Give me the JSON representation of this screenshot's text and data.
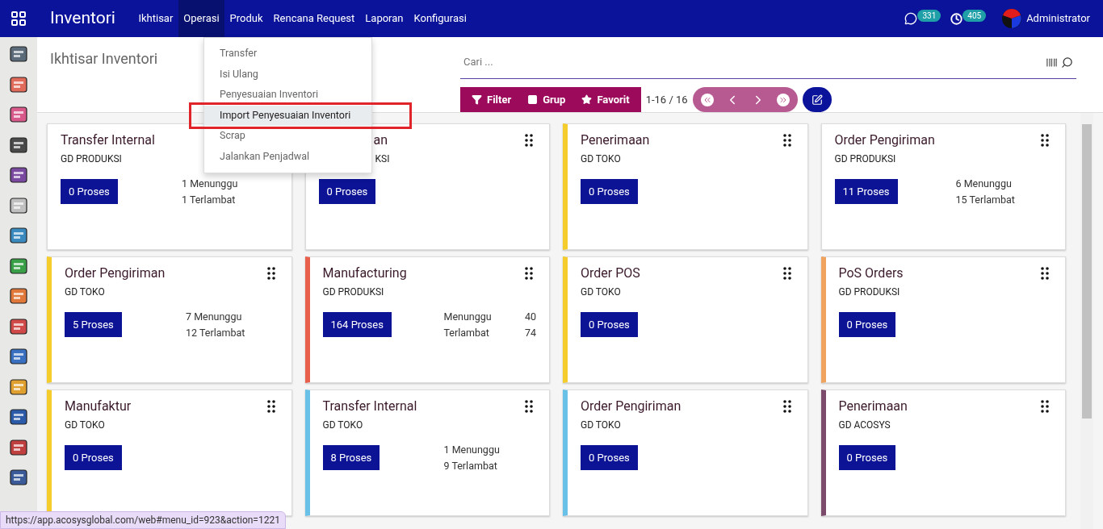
{
  "app_title": "Inventori",
  "nav": [
    {
      "label": "Ikhtisar",
      "selected": false
    },
    {
      "label": "Operasi",
      "selected": true
    },
    {
      "label": "Produk",
      "selected": false
    },
    {
      "label": "Rencana Request",
      "selected": false
    },
    {
      "label": "Laporan",
      "selected": false
    },
    {
      "label": "Konfigurasi",
      "selected": false
    }
  ],
  "messages_count": "331",
  "activities_count": "405",
  "user": "Administrator",
  "dropdown": [
    {
      "label": "Transfer",
      "selected": false
    },
    {
      "label": "Isi Ulang",
      "selected": false
    },
    {
      "label": "Penyesuaian Inventori",
      "selected": false
    },
    {
      "label": "Import Penyesuaian Inventori",
      "selected": true
    },
    {
      "label": "Scrap",
      "selected": false
    },
    {
      "label": "Jalankan Penjadwal",
      "selected": false
    }
  ],
  "breadcrumb": "Ikhtisar Inventori",
  "search": {
    "placeholder": "Cari ..."
  },
  "filters": [
    "Filter",
    "Grup",
    "Favorit"
  ],
  "pager": "1-16 / 16",
  "cards": [
    {
      "title": "Transfer Internal",
      "warehouse": "GD PRODUKSI",
      "button": "0 Proses",
      "kind": "lines",
      "stats": [
        "1 Menunggu",
        "1 Terlambat"
      ]
    },
    {
      "title": "an",
      "warehouse": "KSI",
      "button": "0 Proses",
      "kind": "lines",
      "covered": true
    },
    {
      "title": "Penerimaan",
      "warehouse": "GD TOKO",
      "button": "0 Proses",
      "kind": "lines",
      "color": "#f4cc2c"
    },
    {
      "title": "Order Pengiriman",
      "warehouse": "GD PRODUKSI",
      "button": "11 Proses",
      "kind": "lines",
      "stats": [
        "6 Menunggu",
        "15 Terlambat"
      ]
    },
    {
      "title": "Order Pengiriman",
      "warehouse": "GD TOKO",
      "button": "5 Proses",
      "kind": "lines",
      "stats": [
        "7 Menunggu",
        "12 Terlambat"
      ],
      "color": "#f4cc2c"
    },
    {
      "title": "Manufacturing",
      "warehouse": "GD PRODUKSI",
      "button": "164 Proses",
      "kind": "table",
      "stats": [
        {
          "label": "Menunggu",
          "value": "40"
        },
        {
          "label": "Terlambat",
          "value": "74"
        }
      ],
      "color": "#e8604c"
    },
    {
      "title": "Order POS",
      "warehouse": "GD TOKO",
      "button": "0 Proses",
      "kind": "lines",
      "color": "#f4cc2c"
    },
    {
      "title": "PoS Orders",
      "warehouse": "GD PRODUKSI",
      "button": "0 Proses",
      "kind": "lines",
      "color": "#f0a35e"
    },
    {
      "title": "Manufaktur",
      "warehouse": "GD TOKO",
      "button": "0 Proses",
      "kind": "lines",
      "color": "#f4cc2c"
    },
    {
      "title": "Transfer Internal",
      "warehouse": "GD TOKO",
      "button": "8 Proses",
      "kind": "lines",
      "stats": [
        "1 Menunggu",
        "9 Terlambat"
      ],
      "color": "#6ac1e8"
    },
    {
      "title": "Order Pengiriman",
      "warehouse": "GD TOKO",
      "button": "0 Proses",
      "kind": "lines",
      "color": "#6ac1e8"
    },
    {
      "title": "Penerimaan",
      "warehouse": "GD ACOSYS",
      "button": "0 Proses",
      "kind": "lines",
      "color": "#7c4a6a"
    }
  ],
  "status_url": "https://app.acosysglobal.com/web#menu_id=923&action=1221"
}
